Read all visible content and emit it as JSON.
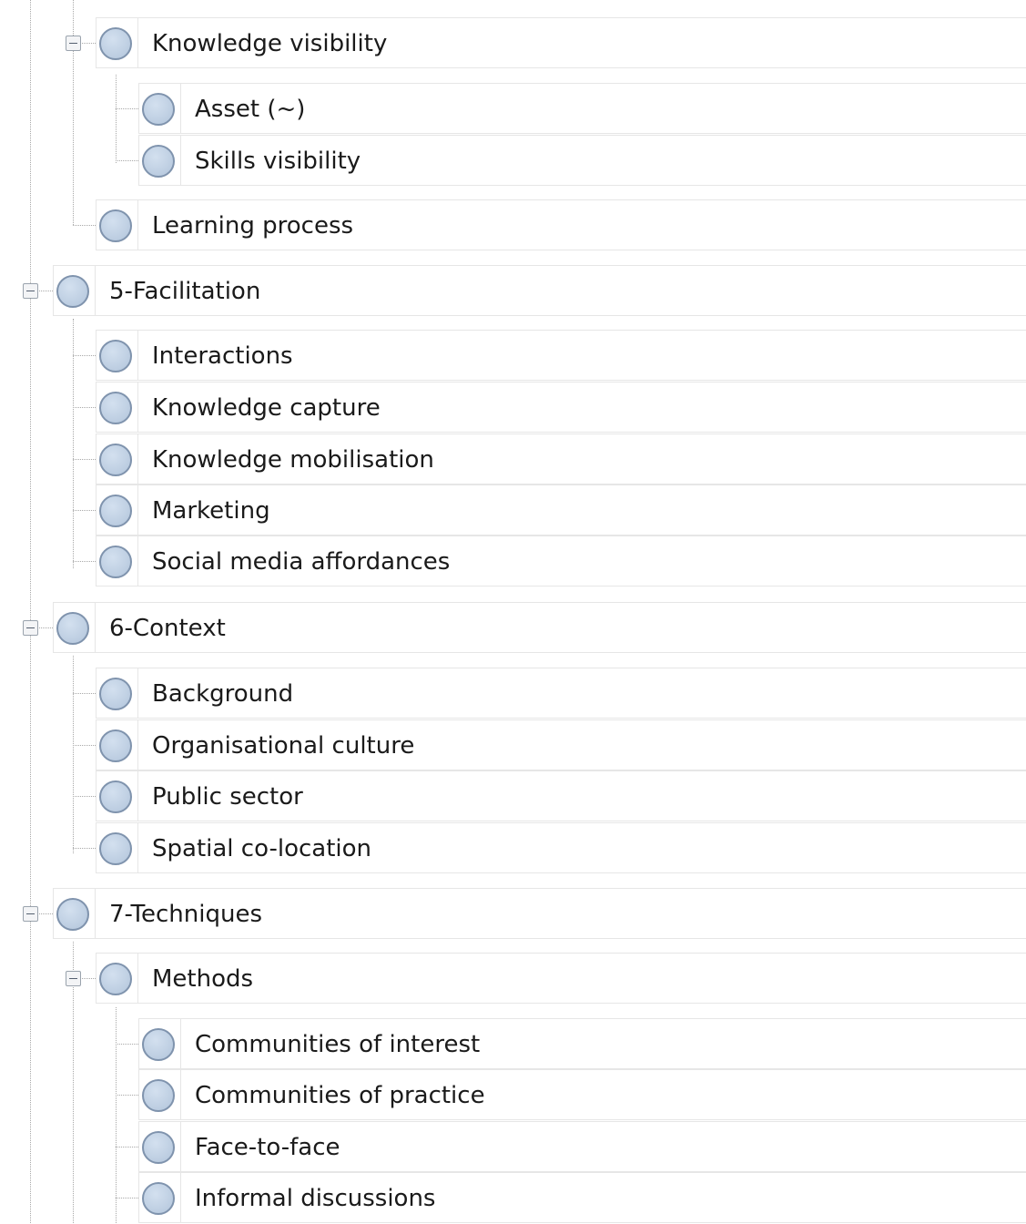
{
  "tree": {
    "nodes": [
      {
        "label": "Knowledge visibility",
        "level": 1,
        "expanded": true
      },
      {
        "label": "Asset (~)",
        "level": 2
      },
      {
        "label": "Skills visibility",
        "level": 2
      },
      {
        "label": "Learning process",
        "level": 1
      },
      {
        "label": "5-Facilitation",
        "level": 0,
        "expanded": true
      },
      {
        "label": "Interactions",
        "level": 1
      },
      {
        "label": "Knowledge capture",
        "level": 1
      },
      {
        "label": "Knowledge mobilisation",
        "level": 1
      },
      {
        "label": "Marketing",
        "level": 1
      },
      {
        "label": "Social media affordances",
        "level": 1
      },
      {
        "label": "6-Context",
        "level": 0,
        "expanded": true
      },
      {
        "label": "Background",
        "level": 1
      },
      {
        "label": "Organisational culture",
        "level": 1
      },
      {
        "label": "Public sector",
        "level": 1
      },
      {
        "label": "Spatial co-location",
        "level": 1
      },
      {
        "label": "7-Techniques",
        "level": 0,
        "expanded": true
      },
      {
        "label": "Methods",
        "level": 1,
        "expanded": true
      },
      {
        "label": "Communities of interest",
        "level": 2
      },
      {
        "label": "Communities of practice",
        "level": 2
      },
      {
        "label": "Face-to-face",
        "level": 2
      },
      {
        "label": "Informal discussions",
        "level": 2
      }
    ]
  },
  "icons": {
    "node": "node-circle-icon",
    "collapse": "collapse-toggle-icon"
  },
  "colors": {
    "node_fill": "#bccde1",
    "node_border": "#7f93ad",
    "row_border": "#e6e6e6",
    "connector": "#a8a8a8"
  }
}
